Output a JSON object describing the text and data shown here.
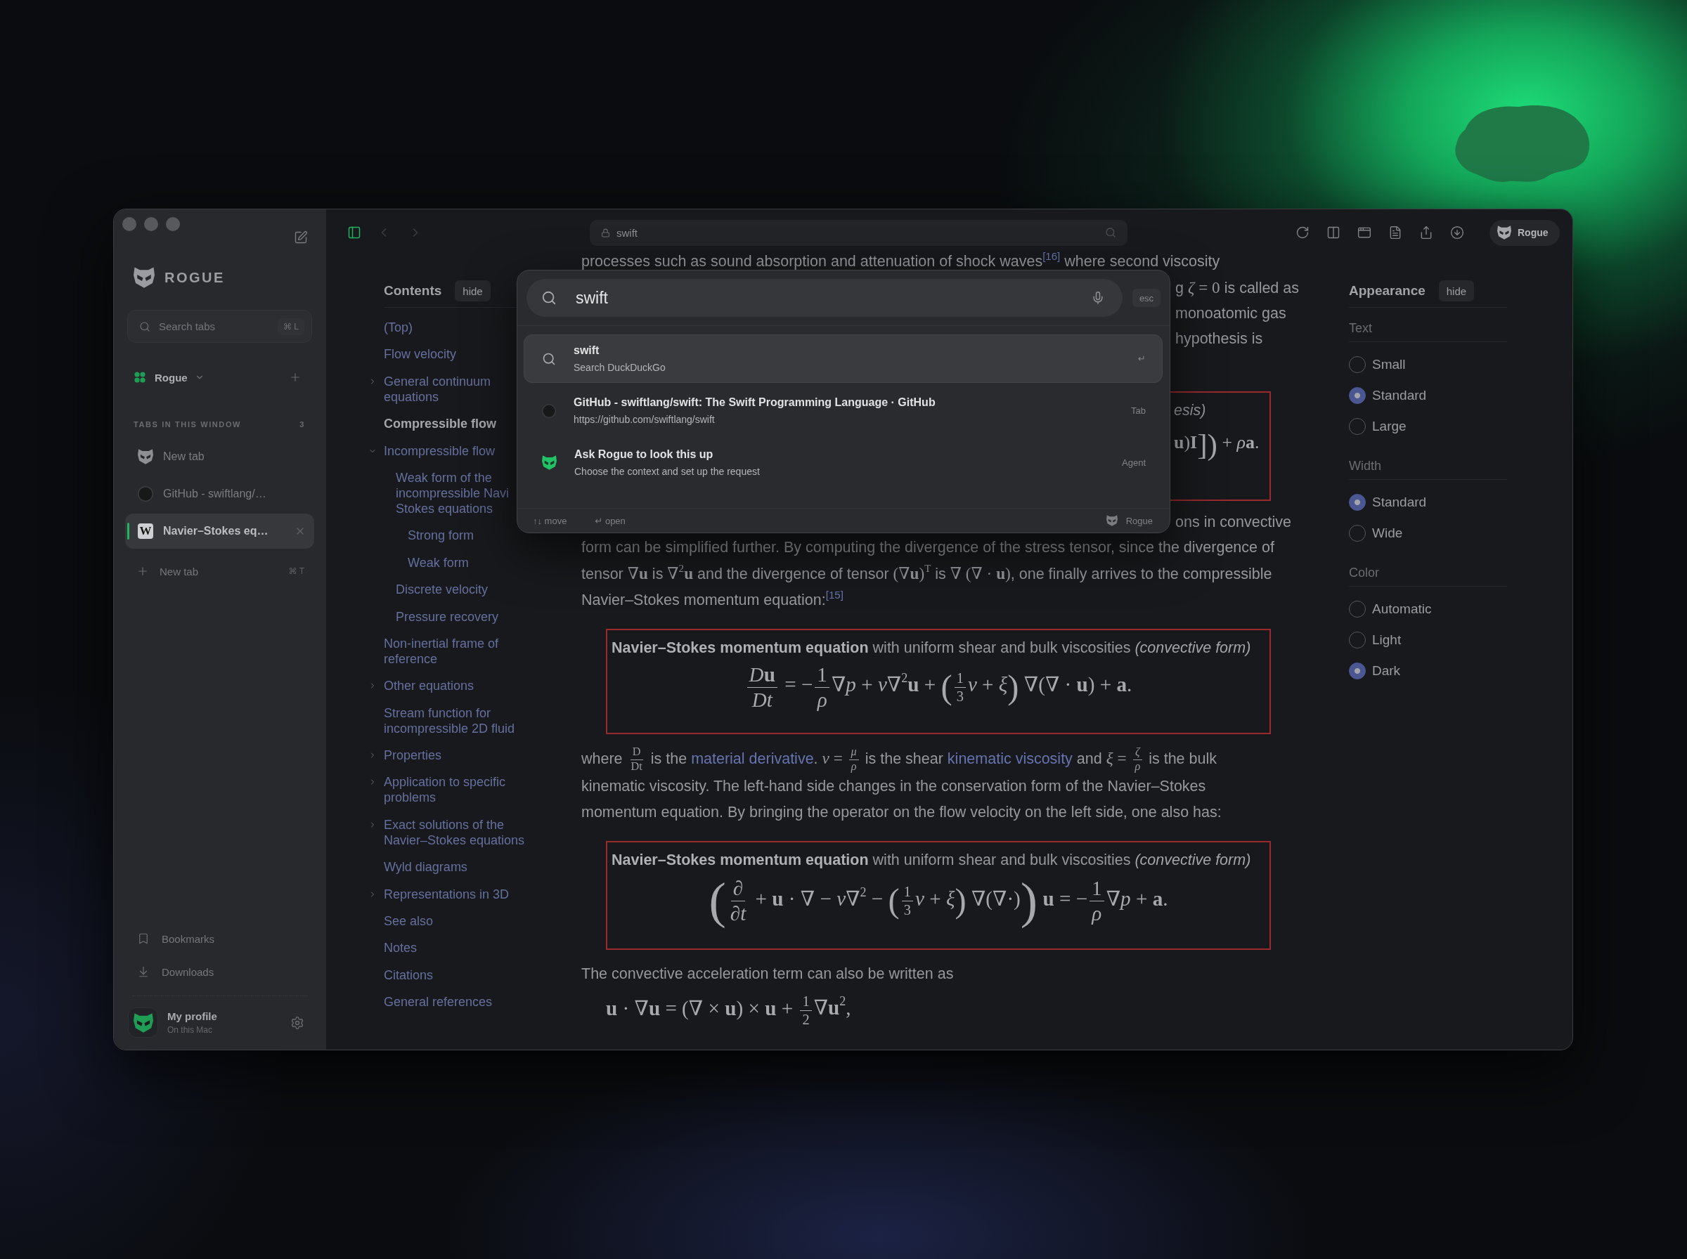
{
  "sidebar": {
    "brand": "ROGUE",
    "search": {
      "placeholder": "Search tabs",
      "shortcut": "⌘ L"
    },
    "space": {
      "label": "Rogue"
    },
    "section": {
      "title": "TABS IN THIS WINDOW",
      "count": "3"
    },
    "tabs": [
      {
        "label": "New tab",
        "kind": "home",
        "selected": false
      },
      {
        "label": "GitHub - swiftlang/…",
        "kind": "site",
        "selected": false
      },
      {
        "label": "Navier–Stokes eq…",
        "kind": "article",
        "icon_text": "W",
        "selected": true
      }
    ],
    "new_tab": {
      "label": "New tab",
      "shortcut": "⌘ T"
    },
    "links": [
      {
        "label": "Bookmarks"
      },
      {
        "label": "Downloads"
      }
    ],
    "profile": {
      "name": "My profile",
      "subtitle": "On this Mac"
    }
  },
  "toolbar": {
    "sidebar_on": true,
    "back_disabled": true,
    "forward_disabled": true,
    "address": "swift",
    "profile": "Rogue"
  },
  "contents": {
    "title": "Contents",
    "hide": "hide",
    "items": [
      {
        "label": "(Top)",
        "selected": false
      },
      {
        "label": "Flow velocity",
        "selected": false
      },
      {
        "label": "General continuum equations",
        "selected": false,
        "expanded": false
      },
      {
        "label": "Compressible flow",
        "selected": true
      },
      {
        "label": "Incompressible flow",
        "selected": false,
        "expanded": true,
        "children": [
          {
            "label": "Weak form of the incompressible Navi Stokes equations",
            "selected": false,
            "children": [
              {
                "label": "Strong form",
                "selected": false
              },
              {
                "label": "Weak form",
                "selected": false
              }
            ]
          },
          {
            "label": "Discrete velocity",
            "selected": false
          },
          {
            "label": "Pressure recovery",
            "selected": false
          }
        ]
      },
      {
        "label": "Non-inertial frame of reference",
        "selected": false
      },
      {
        "label": "Other equations",
        "selected": false,
        "expanded": false
      },
      {
        "label": "Stream function for incompressible 2D fluid",
        "selected": false
      },
      {
        "label": "Properties",
        "selected": false,
        "expanded": false
      },
      {
        "label": "Application to specific problems",
        "selected": false,
        "expanded": false
      },
      {
        "label": "Exact solutions of the Navier–Stokes equations",
        "selected": false,
        "expanded": false
      },
      {
        "label": "Wyld diagrams",
        "selected": false
      },
      {
        "label": "Representations in 3D",
        "selected": false,
        "expanded": false
      },
      {
        "label": "See also",
        "selected": false
      },
      {
        "label": "Notes",
        "selected": false
      },
      {
        "label": "Citations",
        "selected": false
      },
      {
        "label": "General references",
        "selected": false
      }
    ]
  },
  "article": {
    "blocks": [
      {
        "kind": "line",
        "segments": [
          {
            "kind": "text",
            "text": "processes such as sound absorption and attenuation of shock waves"
          },
          {
            "kind": "cite",
            "text": "[16]"
          },
          {
            "kind": "text",
            "text": " where second viscosity"
          }
        ]
      },
      {
        "kind": "fragment",
        "segments": [
          {
            "kind": "text",
            "text": "g "
          },
          {
            "kind": "math",
            "text": "*ζ* = 0"
          },
          {
            "kind": "text",
            "text": " is called as"
          }
        ]
      },
      {
        "kind": "fragment",
        "segments": [
          {
            "kind": "text",
            "text": "monoatomic gas"
          }
        ]
      },
      {
        "kind": "fragment",
        "segments": [
          {
            "kind": "text",
            "text": "hypothesis is"
          }
        ]
      },
      {
        "kind": "covered_box",
        "title": "esis)",
        "formula": [
          {
            "kind": "math",
            "text": "**u**)**I**"
          },
          {
            "kind": "big",
            "text": "]"
          },
          {
            "kind": "big",
            "text": ")"
          },
          {
            "kind": "math",
            "text": " + *ρ*"
          },
          {
            "kind": "math",
            "text": "**a**."
          }
        ]
      },
      {
        "kind": "fragment",
        "segments": [
          {
            "kind": "text",
            "text": "ons in convective"
          }
        ]
      },
      {
        "kind": "paragraph",
        "segments": [
          {
            "kind": "text",
            "text": "form can be simplified further. By computing the divergence of the stress tensor, since the divergence of tensor "
          },
          {
            "kind": "math",
            "text": "∇**u**"
          },
          {
            "kind": "text",
            "text": " is "
          },
          {
            "kind": "math",
            "text": "∇$^{2}$**u**"
          },
          {
            "kind": "text",
            "text": " and the divergence of tensor "
          },
          {
            "kind": "math",
            "text": "(∇**u**)$^{T}$"
          },
          {
            "kind": "text",
            "text": " is "
          },
          {
            "kind": "math",
            "text": "∇ (∇ · **u**)"
          },
          {
            "kind": "text",
            "text": ", one finally arrives to the compressible Navier–Stokes momentum equation:"
          },
          {
            "kind": "cite",
            "text": "[15]"
          }
        ]
      },
      {
        "kind": "box",
        "title": "**Navier–Stokes momentum equation** with uniform shear and bulk viscosities *(convective form)*",
        "formula": [
          {
            "kind": "frac",
            "num": [
              {
                "kind": "math",
                "text": "*D*"
              },
              {
                "kind": "math",
                "text": "**u**"
              }
            ],
            "den": [
              {
                "kind": "math",
                "text": "*Dt*"
              }
            ]
          },
          {
            "kind": "math",
            "text": " = −"
          },
          {
            "kind": "frac",
            "num": [
              {
                "kind": "math",
                "text": "1"
              }
            ],
            "den": [
              {
                "kind": "math",
                "text": "*ρ*"
              }
            ]
          },
          {
            "kind": "math",
            "text": "∇*p* + *ν*∇$^{2}$**u** + "
          },
          {
            "kind": "big",
            "text": "("
          },
          {
            "kind": "small_frac",
            "num": [
              {
                "kind": "math",
                "text": "1"
              }
            ],
            "den": [
              {
                "kind": "math",
                "text": "3"
              }
            ]
          },
          {
            "kind": "math",
            "text": "*ν* + *ξ*"
          },
          {
            "kind": "big",
            "text": ")"
          },
          {
            "kind": "math",
            "text": " ∇(∇ · **u**) + **a**."
          }
        ]
      },
      {
        "kind": "paragraph",
        "segments": [
          {
            "kind": "text",
            "text": "where "
          },
          {
            "kind": "small_frac",
            "num": [
              {
                "kind": "math",
                "text": "D"
              }
            ],
            "den": [
              {
                "kind": "math",
                "text": "Dt"
              }
            ]
          },
          {
            "kind": "text",
            "text": " is the "
          },
          {
            "kind": "link",
            "text": "material derivative"
          },
          {
            "kind": "text",
            "text": ". "
          },
          {
            "kind": "math",
            "text": "*ν* = "
          },
          {
            "kind": "small_frac",
            "num": [
              {
                "kind": "math",
                "text": "*μ*"
              }
            ],
            "den": [
              {
                "kind": "math",
                "text": "*ρ*"
              }
            ]
          },
          {
            "kind": "text",
            "text": " is the shear "
          },
          {
            "kind": "link",
            "text": "kinematic viscosity"
          },
          {
            "kind": "text",
            "text": " and "
          },
          {
            "kind": "math",
            "text": "*ξ* = "
          },
          {
            "kind": "small_frac",
            "num": [
              {
                "kind": "math",
                "text": "*ζ*"
              }
            ],
            "den": [
              {
                "kind": "math",
                "text": "*ρ*"
              }
            ]
          },
          {
            "kind": "text",
            "text": " is the bulk kinematic viscosity. The left-hand side changes in the conservation form of the Navier–Stokes momentum equation. By bringing the operator on the flow velocity on the left side, one also has:"
          }
        ]
      },
      {
        "kind": "box",
        "title": "**Navier–Stokes momentum equation** with uniform shear and bulk viscosities *(convective form)*",
        "formula": [
          {
            "kind": "huge",
            "text": "("
          },
          {
            "kind": "frac",
            "num": [
              {
                "kind": "math",
                "text": "∂"
              }
            ],
            "den": [
              {
                "kind": "math",
                "text": "∂*t*"
              }
            ]
          },
          {
            "kind": "math",
            "text": " + **u** · ∇ − *ν*∇$^{2}$ − "
          },
          {
            "kind": "big",
            "text": "("
          },
          {
            "kind": "small_frac",
            "num": [
              {
                "kind": "math",
                "text": "1"
              }
            ],
            "den": [
              {
                "kind": "math",
                "text": "3"
              }
            ]
          },
          {
            "kind": "math",
            "text": "*ν* + *ξ*"
          },
          {
            "kind": "big",
            "text": ")"
          },
          {
            "kind": "math",
            "text": " ∇(∇·)"
          },
          {
            "kind": "huge",
            "text": ")"
          },
          {
            "kind": "math",
            "text": " **u** = −"
          },
          {
            "kind": "frac",
            "num": [
              {
                "kind": "math",
                "text": "1"
              }
            ],
            "den": [
              {
                "kind": "math",
                "text": "*ρ*"
              }
            ]
          },
          {
            "kind": "math",
            "text": "∇*p* + **a**."
          }
        ]
      },
      {
        "kind": "paragraph",
        "segments": [
          {
            "kind": "text",
            "text": "The convective acceleration term can also be written as"
          }
        ]
      },
      {
        "kind": "formula",
        "formula": [
          {
            "kind": "math",
            "text": "**u** · ∇**u** = (∇ × **u**) × **u** + "
          },
          {
            "kind": "small_frac",
            "num": [
              {
                "kind": "math",
                "text": "1"
              }
            ],
            "den": [
              {
                "kind": "math",
                "text": "2"
              }
            ]
          },
          {
            "kind": "math",
            "text": "∇**u**$^{2}$,"
          }
        ]
      }
    ]
  },
  "appearance": {
    "title": "Appearance",
    "hide": "hide",
    "groups": [
      {
        "label": "Text",
        "options": [
          {
            "label": "Small",
            "selected": false
          },
          {
            "label": "Standard",
            "selected": true
          },
          {
            "label": "Large",
            "selected": false
          }
        ]
      },
      {
        "label": "Width",
        "options": [
          {
            "label": "Standard",
            "selected": true
          },
          {
            "label": "Wide",
            "selected": false
          }
        ]
      },
      {
        "label": "Color",
        "options": [
          {
            "label": "Automatic",
            "selected": false
          },
          {
            "label": "Light",
            "selected": false
          },
          {
            "label": "Dark",
            "selected": true
          }
        ]
      }
    ]
  },
  "palette": {
    "query": "swift",
    "esc": "esc",
    "results": [
      {
        "title": "swift",
        "subtitle": "Search DuckDuckGo",
        "hint": "↵",
        "kind": "search",
        "selected": true
      },
      {
        "title": "GitHub - swiftlang/swift: The Swift Programming Language · GitHub",
        "subtitle": "https://github.com/swiftlang/swift",
        "hint": "Tab",
        "kind": "site",
        "selected": false
      },
      {
        "title": "Ask Rogue to look this up",
        "subtitle": "Choose the context and set up the request",
        "hint": "Agent",
        "kind": "agent",
        "selected": false
      }
    ],
    "hints": [
      "↑↓ move",
      "↵ open"
    ],
    "brand": "Rogue"
  }
}
